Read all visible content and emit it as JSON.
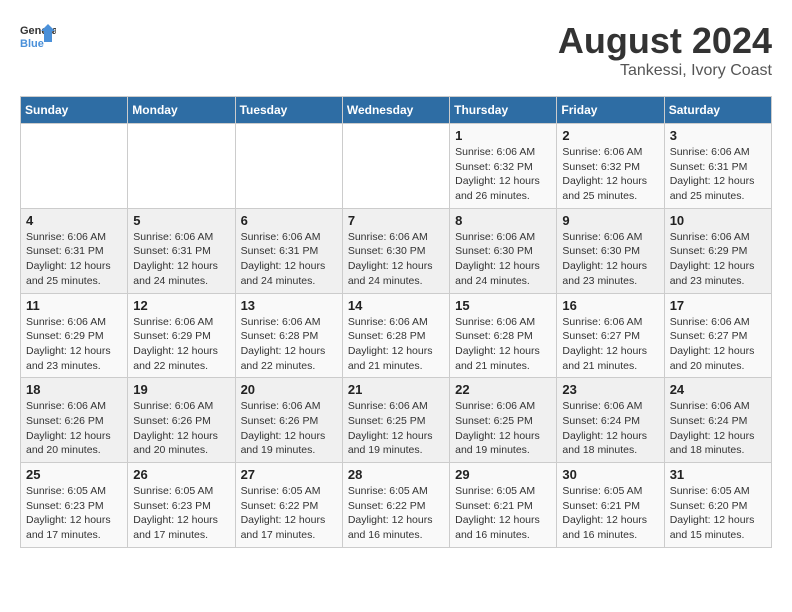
{
  "header": {
    "logo_line1": "General",
    "logo_line2": "Blue",
    "main_title": "August 2024",
    "subtitle": "Tankessi, Ivory Coast"
  },
  "days_of_week": [
    "Sunday",
    "Monday",
    "Tuesday",
    "Wednesday",
    "Thursday",
    "Friday",
    "Saturday"
  ],
  "weeks": [
    [
      {
        "day": "",
        "text": ""
      },
      {
        "day": "",
        "text": ""
      },
      {
        "day": "",
        "text": ""
      },
      {
        "day": "",
        "text": ""
      },
      {
        "day": "1",
        "text": "Sunrise: 6:06 AM\nSunset: 6:32 PM\nDaylight: 12 hours\nand 26 minutes."
      },
      {
        "day": "2",
        "text": "Sunrise: 6:06 AM\nSunset: 6:32 PM\nDaylight: 12 hours\nand 25 minutes."
      },
      {
        "day": "3",
        "text": "Sunrise: 6:06 AM\nSunset: 6:31 PM\nDaylight: 12 hours\nand 25 minutes."
      }
    ],
    [
      {
        "day": "4",
        "text": "Sunrise: 6:06 AM\nSunset: 6:31 PM\nDaylight: 12 hours\nand 25 minutes."
      },
      {
        "day": "5",
        "text": "Sunrise: 6:06 AM\nSunset: 6:31 PM\nDaylight: 12 hours\nand 24 minutes."
      },
      {
        "day": "6",
        "text": "Sunrise: 6:06 AM\nSunset: 6:31 PM\nDaylight: 12 hours\nand 24 minutes."
      },
      {
        "day": "7",
        "text": "Sunrise: 6:06 AM\nSunset: 6:30 PM\nDaylight: 12 hours\nand 24 minutes."
      },
      {
        "day": "8",
        "text": "Sunrise: 6:06 AM\nSunset: 6:30 PM\nDaylight: 12 hours\nand 24 minutes."
      },
      {
        "day": "9",
        "text": "Sunrise: 6:06 AM\nSunset: 6:30 PM\nDaylight: 12 hours\nand 23 minutes."
      },
      {
        "day": "10",
        "text": "Sunrise: 6:06 AM\nSunset: 6:29 PM\nDaylight: 12 hours\nand 23 minutes."
      }
    ],
    [
      {
        "day": "11",
        "text": "Sunrise: 6:06 AM\nSunset: 6:29 PM\nDaylight: 12 hours\nand 23 minutes."
      },
      {
        "day": "12",
        "text": "Sunrise: 6:06 AM\nSunset: 6:29 PM\nDaylight: 12 hours\nand 22 minutes."
      },
      {
        "day": "13",
        "text": "Sunrise: 6:06 AM\nSunset: 6:28 PM\nDaylight: 12 hours\nand 22 minutes."
      },
      {
        "day": "14",
        "text": "Sunrise: 6:06 AM\nSunset: 6:28 PM\nDaylight: 12 hours\nand 21 minutes."
      },
      {
        "day": "15",
        "text": "Sunrise: 6:06 AM\nSunset: 6:28 PM\nDaylight: 12 hours\nand 21 minutes."
      },
      {
        "day": "16",
        "text": "Sunrise: 6:06 AM\nSunset: 6:27 PM\nDaylight: 12 hours\nand 21 minutes."
      },
      {
        "day": "17",
        "text": "Sunrise: 6:06 AM\nSunset: 6:27 PM\nDaylight: 12 hours\nand 20 minutes."
      }
    ],
    [
      {
        "day": "18",
        "text": "Sunrise: 6:06 AM\nSunset: 6:26 PM\nDaylight: 12 hours\nand 20 minutes."
      },
      {
        "day": "19",
        "text": "Sunrise: 6:06 AM\nSunset: 6:26 PM\nDaylight: 12 hours\nand 20 minutes."
      },
      {
        "day": "20",
        "text": "Sunrise: 6:06 AM\nSunset: 6:26 PM\nDaylight: 12 hours\nand 19 minutes."
      },
      {
        "day": "21",
        "text": "Sunrise: 6:06 AM\nSunset: 6:25 PM\nDaylight: 12 hours\nand 19 minutes."
      },
      {
        "day": "22",
        "text": "Sunrise: 6:06 AM\nSunset: 6:25 PM\nDaylight: 12 hours\nand 19 minutes."
      },
      {
        "day": "23",
        "text": "Sunrise: 6:06 AM\nSunset: 6:24 PM\nDaylight: 12 hours\nand 18 minutes."
      },
      {
        "day": "24",
        "text": "Sunrise: 6:06 AM\nSunset: 6:24 PM\nDaylight: 12 hours\nand 18 minutes."
      }
    ],
    [
      {
        "day": "25",
        "text": "Sunrise: 6:05 AM\nSunset: 6:23 PM\nDaylight: 12 hours\nand 17 minutes."
      },
      {
        "day": "26",
        "text": "Sunrise: 6:05 AM\nSunset: 6:23 PM\nDaylight: 12 hours\nand 17 minutes."
      },
      {
        "day": "27",
        "text": "Sunrise: 6:05 AM\nSunset: 6:22 PM\nDaylight: 12 hours\nand 17 minutes."
      },
      {
        "day": "28",
        "text": "Sunrise: 6:05 AM\nSunset: 6:22 PM\nDaylight: 12 hours\nand 16 minutes."
      },
      {
        "day": "29",
        "text": "Sunrise: 6:05 AM\nSunset: 6:21 PM\nDaylight: 12 hours\nand 16 minutes."
      },
      {
        "day": "30",
        "text": "Sunrise: 6:05 AM\nSunset: 6:21 PM\nDaylight: 12 hours\nand 16 minutes."
      },
      {
        "day": "31",
        "text": "Sunrise: 6:05 AM\nSunset: 6:20 PM\nDaylight: 12 hours\nand 15 minutes."
      }
    ]
  ]
}
